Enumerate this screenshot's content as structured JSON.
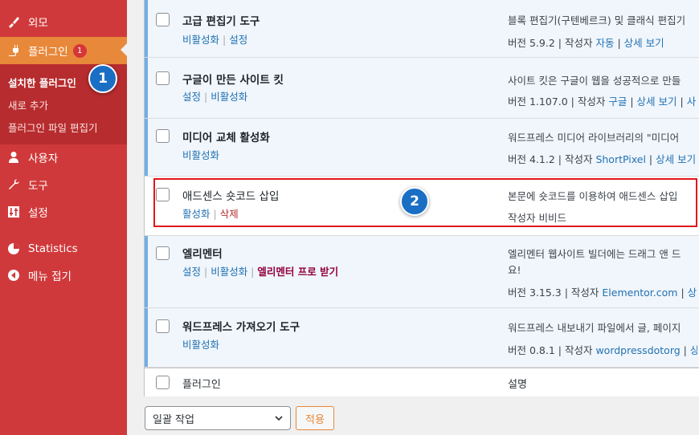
{
  "sidebar": {
    "items": [
      {
        "label": "외모",
        "icon": "brush-icon"
      },
      {
        "label": "플러그인",
        "icon": "plug-icon",
        "badge": "1"
      },
      {
        "label": "사용자",
        "icon": "user-icon"
      },
      {
        "label": "도구",
        "icon": "wrench-icon"
      },
      {
        "label": "설정",
        "icon": "settings-icon"
      },
      {
        "label": "Statistics",
        "icon": "pie-chart-icon"
      },
      {
        "label": "메뉴 접기",
        "icon": "collapse-icon"
      }
    ],
    "submenu": [
      "설치한 플러그인",
      "새로 추가",
      "플러그인 파일 편집기"
    ]
  },
  "plugins": [
    {
      "name": "고급 편집기 도구",
      "actions": [
        "비활성화",
        "설정"
      ],
      "desc": "블록 편집기(구텐베르크) 및 클래식 편집기",
      "meta": {
        "version": "버전 5.9.2",
        "author_prefix": "작성자",
        "author": "자동",
        "detail": "상세 보기"
      }
    },
    {
      "name": "구글이 만든 사이트 킷",
      "actions": [
        "설정",
        "비활성화"
      ],
      "desc": "사이트 킷은 구글이 웹을 성공적으로 만들",
      "meta": {
        "version": "버전 1.107.0",
        "author_prefix": "작성자",
        "author": "구글",
        "detail": "상세 보기",
        "extra": "사"
      }
    },
    {
      "name": "미디어 교체 활성화",
      "actions": [
        "비활성화"
      ],
      "desc": "워드프레스 미디어 라이브러리의 \"미디어",
      "meta": {
        "version": "버전 4.1.2",
        "author_prefix": "작성자",
        "author": "ShortPixel",
        "detail": "상세 보기"
      }
    },
    {
      "name": "애드센스 숏코드 삽입",
      "actions": [
        "활성화",
        "삭제"
      ],
      "desc": "본문에 숏코드를 이용하여 애드센스 삽입",
      "meta_text": "작성자 비비드"
    },
    {
      "name": "엘리멘터",
      "actions": [
        "설정",
        "비활성화",
        "엘리멘터 프로 받기"
      ],
      "desc": "엘리멘터 웹사이트 빌더에는 드래그 앤 드",
      "desc2": "요!",
      "meta": {
        "version": "버전 3.15.3",
        "author_prefix": "작성자",
        "author": "Elementor.com",
        "detail": "상세"
      }
    },
    {
      "name": "워드프레스 가져오기 도구",
      "actions": [
        "비활성화"
      ],
      "desc": "워드프레스 내보내기 파일에서 글, 페이지",
      "meta": {
        "version": "버전 0.8.1",
        "author_prefix": "작성자",
        "author": "wordpressdotorg",
        "detail": "상세"
      }
    }
  ],
  "footer": {
    "col1": "플러그인",
    "col2": "설명"
  },
  "bulk": {
    "select_value": "일괄 작업",
    "apply": "적용"
  },
  "markers": [
    "1",
    "2"
  ]
}
